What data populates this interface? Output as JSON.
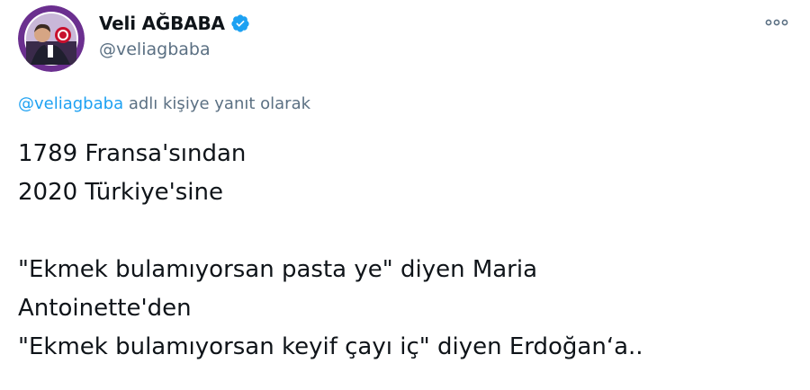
{
  "tweet": {
    "author": {
      "display_name": "Veli AĞBABA",
      "handle": "@veliagbaba",
      "verified": true,
      "avatar_icon": "profile-photo"
    },
    "more_icon": "more-horizontal-icon",
    "reply_to": {
      "mention": "@veliagbaba",
      "suffix": " adlı kişiye yanıt olarak"
    },
    "text_lines": [
      "1789 Fransa'sından",
      "2020 Türkiye'sine",
      "",
      "\"Ekmek bulamıyorsan pasta ye\" diyen Maria",
      "Antoinette'den",
      "\"Ekmek bulamıyorsan keyif çayı iç\" diyen Erdoğan‘a.."
    ]
  },
  "colors": {
    "text_primary": "#0f1419",
    "text_secondary": "#5b7083",
    "link": "#1da1f2",
    "verified_badge": "#1da1f2",
    "avatar_ring": "#6b2f8f"
  }
}
